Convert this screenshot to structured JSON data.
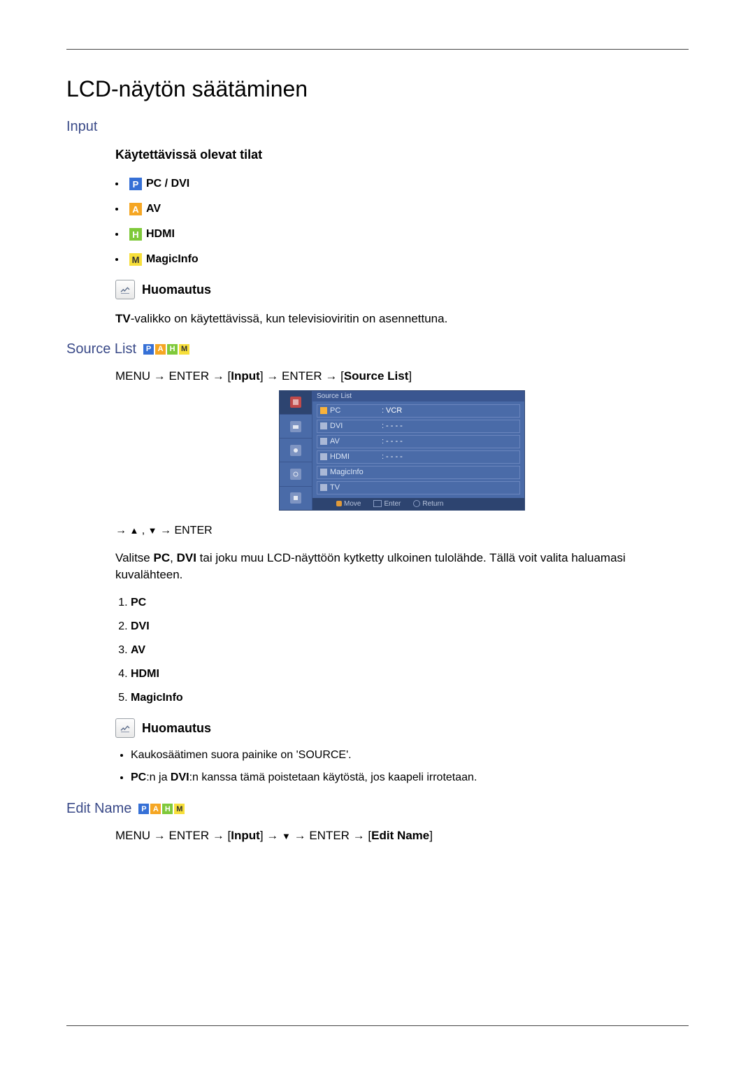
{
  "title": "LCD-näytön säätäminen",
  "section_input": "Input",
  "subhead_modes": "Käytettävissä olevat tilat",
  "modes": {
    "pc_dvi": "PC / DVI",
    "av": "AV",
    "hdmi": "HDMI",
    "magicinfo": "MagicInfo"
  },
  "note_label": "Huomautus",
  "tv_note_prefix": "TV",
  "tv_note_rest": "-valikko on käytettävissä, kun televisioviritin on asennettuna.",
  "section_sourcelist": "Source List",
  "sourcelist_path": {
    "p1": "MENU → ENTER → [",
    "b1": "Input",
    "p2": "] → ENTER → [",
    "b2": "Source List",
    "p3": "]"
  },
  "osd": {
    "title": "Source List",
    "rows": [
      {
        "label": "PC",
        "value": "VCR",
        "selected": true
      },
      {
        "label": "DVI",
        "value": "- - - -"
      },
      {
        "label": "AV",
        "value": "- - - -"
      },
      {
        "label": "HDMI",
        "value": "- - - -"
      },
      {
        "label": "MagicInfo",
        "value": ""
      },
      {
        "label": "TV",
        "value": ""
      }
    ],
    "footer": {
      "move": "Move",
      "enter": "Enter",
      "return": "Return"
    }
  },
  "nav_hint_prefix": "→ ",
  "nav_hint_mid": " , ",
  "nav_hint_suffix": " → ENTER",
  "desc_prefix": "Valitse ",
  "desc_b1": "PC",
  "desc_sep": ", ",
  "desc_b2": "DVI",
  "desc_rest": " tai joku muu LCD-näyttöön kytketty ulkoinen tulolähde. Tällä voit valita haluamasi kuvalähteen.",
  "numlist": [
    "PC",
    "DVI",
    "AV",
    "HDMI",
    "MagicInfo"
  ],
  "bullets": {
    "b1": "Kaukosäätimen suora painike on 'SOURCE'.",
    "b2_b1": "PC",
    "b2_mid": ":n ja ",
    "b2_b2": "DVI",
    "b2_rest": ":n kanssa tämä poistetaan käytöstä, jos kaapeli irrotetaan."
  },
  "section_editname": "Edit Name",
  "editname_path": {
    "p1": "MENU → ENTER → [",
    "b1": "Input",
    "p2": "] → ",
    "arrow": "▼",
    "p3": " → ENTER → [",
    "b2": "Edit Name",
    "p4": "]"
  }
}
